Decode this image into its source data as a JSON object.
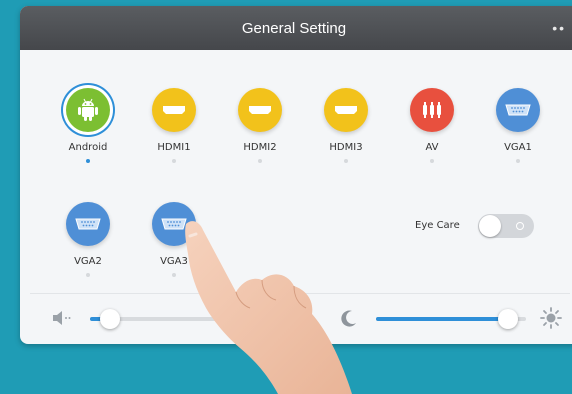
{
  "window": {
    "title": "General Setting"
  },
  "colors": {
    "accent": "#2e8fd8",
    "hdmi": "#f2c21b",
    "android": "#7cbf32",
    "av": "#e8503e",
    "vga": "#4f8fd6",
    "background": "#1f9cb5"
  },
  "sources": [
    {
      "label": "Android",
      "icon": "android-icon",
      "selected": true
    },
    {
      "label": "HDMI1",
      "icon": "hdmi-icon",
      "selected": false
    },
    {
      "label": "HDMI2",
      "icon": "hdmi-icon",
      "selected": false
    },
    {
      "label": "HDMI3",
      "icon": "hdmi-icon",
      "selected": false
    },
    {
      "label": "AV",
      "icon": "av-icon",
      "selected": false
    },
    {
      "label": "VGA1",
      "icon": "vga-icon",
      "selected": false
    },
    {
      "label": "VGA2",
      "icon": "vga-icon",
      "selected": false
    },
    {
      "label": "VGA3",
      "icon": "vga-icon",
      "selected": false
    }
  ],
  "eye_care": {
    "label": "Eye Care",
    "enabled": false
  },
  "volume": {
    "icon": "volume-mute-icon",
    "level": 0.14
  },
  "brightness": {
    "icon_low": "moon-icon",
    "icon_high": "sun-icon",
    "level": 0.88
  }
}
